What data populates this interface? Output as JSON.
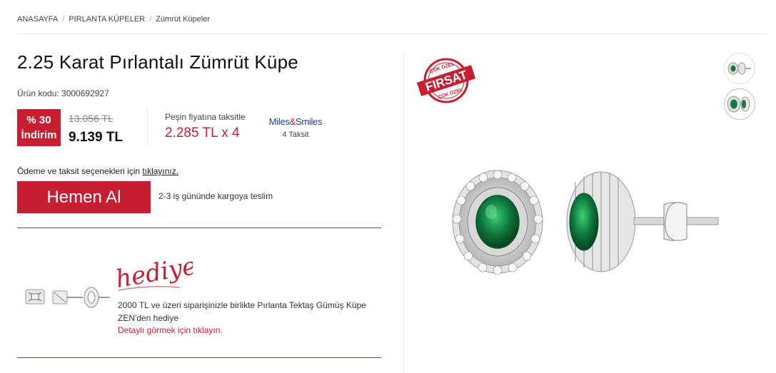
{
  "breadcrumb": {
    "items": [
      "ANASAYFA",
      "PIRLANTA KÜPELER",
      "Zümrüt Küpeler"
    ],
    "separator": "/"
  },
  "product": {
    "title": "2.25 Karat Pırlantalı Zümrüt Küpe",
    "code_label": "Ürün kodu: 3000692927"
  },
  "pricing": {
    "discount_line1": "% 30",
    "discount_line2": "İndirim",
    "old_price": "13.056 TL",
    "new_price": "9.139 TL",
    "installment_label": "Peşin fiyatına taksitle",
    "installment_value": "2.285 TL x 4",
    "miles_logo_left": "Miles",
    "miles_logo_amp": "&",
    "miles_logo_right": "Smiles",
    "miles_sub": "4 Taksit"
  },
  "payment": {
    "text": "Ödeme ve taksit seçenekleri için ",
    "link": "tıklayınız."
  },
  "buy": {
    "button_label": "Hemen Al",
    "cargo_text": "2-3 iş gününde kargoya teslim"
  },
  "gift": {
    "script_title": "hediye!",
    "description": "2000 TL ve üzeri siparişinizle birlikte Pırlanta Tektaş Gümüş Küpe ZEN'den hediye",
    "link": "Detaylı görmek için tıklayın."
  },
  "badge": {
    "top_text": "ÇOK ÖZEL",
    "main_text": "FIRSAT",
    "bottom_text": "ÇOK ÖZEL"
  },
  "colors": {
    "brand_red": "#c81e32",
    "emerald": "#0f7a3e",
    "miles_blue": "#1c3e8c"
  }
}
